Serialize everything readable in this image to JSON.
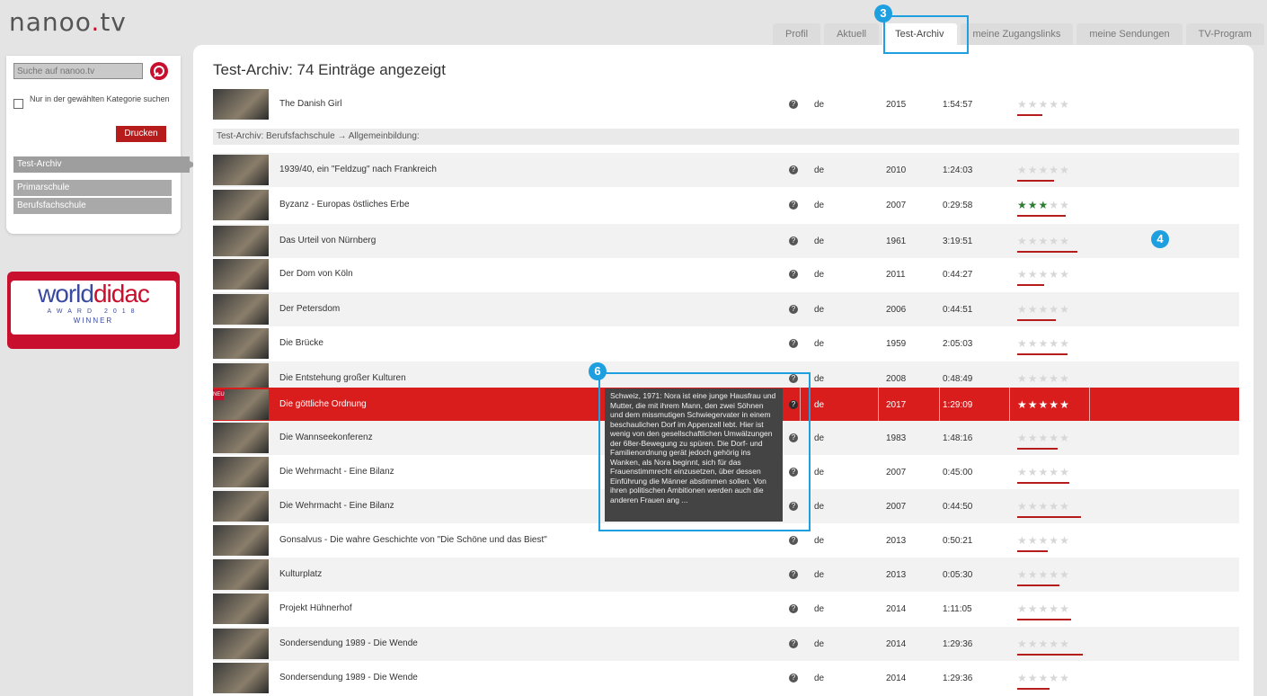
{
  "header": {
    "logo": "nanoo.tv",
    "tabs": [
      "Profil",
      "Aktuell",
      "Test-Archiv",
      "meine Zugangslinks",
      "meine Sendungen",
      "TV-Program"
    ]
  },
  "sidebar": {
    "search_placeholder": "Suche auf nanoo.tv",
    "category_label": "Nur in der gewählten Kategorie suchen",
    "print_label": "Drucken",
    "nav": [
      "Test-Archiv",
      "Primarschule",
      "Berufsfachschule"
    ]
  },
  "award": {
    "word1": "world",
    "word2": "didac",
    "sub": "AWARD 2018",
    "winner": "WINNER"
  },
  "main": {
    "title": "Test-Archiv: 74 Einträge angezeigt",
    "section": "Test-Archiv: Berufsfachschule → Allgemeinbildung:",
    "rows": [
      {
        "title": "The Danish Girl",
        "lang": "de",
        "year": "2015",
        "duration": "1:54:57",
        "rating": 0
      },
      {
        "title": "1939/40, ein \"Feldzug\" nach Frankreich",
        "lang": "de",
        "year": "2010",
        "duration": "1:24:03",
        "rating": 0
      },
      {
        "title": "Byzanz - Europas östliches Erbe",
        "lang": "de",
        "year": "2007",
        "duration": "0:29:58",
        "rating": 3
      },
      {
        "title": "Das Urteil von Nürnberg",
        "lang": "de",
        "year": "1961",
        "duration": "3:19:51",
        "rating": 0
      },
      {
        "title": "Der Dom von Köln",
        "lang": "de",
        "year": "2011",
        "duration": "0:44:27",
        "rating": 0
      },
      {
        "title": "Der Petersdom",
        "lang": "de",
        "year": "2006",
        "duration": "0:44:51",
        "rating": 0
      },
      {
        "title": "Die Brücke",
        "lang": "de",
        "year": "1959",
        "duration": "2:05:03",
        "rating": 0
      },
      {
        "title": "Die Entstehung großer Kulturen",
        "lang": "de",
        "year": "2008",
        "duration": "0:48:49",
        "rating": 0
      },
      {
        "title": "Die göttliche Ordnung",
        "lang": "de",
        "year": "2017",
        "duration": "1:29:09",
        "rating": 5,
        "badge": "NEU"
      },
      {
        "title": "Die Wannseekonferenz",
        "lang": "de",
        "year": "1983",
        "duration": "1:48:16",
        "rating": 0
      },
      {
        "title": "Die Wehrmacht - Eine Bilanz",
        "lang": "de",
        "year": "2007",
        "duration": "0:45:00",
        "rating": 0
      },
      {
        "title": "Die Wehrmacht - Eine Bilanz",
        "lang": "de",
        "year": "2007",
        "duration": "0:44:50",
        "rating": 0
      },
      {
        "title": "Gonsalvus - Die wahre Geschichte von \"Die Schöne und das Biest\"",
        "lang": "de",
        "year": "2013",
        "duration": "0:50:21",
        "rating": 0
      },
      {
        "title": "Kulturplatz",
        "lang": "de",
        "year": "2013",
        "duration": "0:05:30",
        "rating": 0
      },
      {
        "title": "Projekt Hühnerhof",
        "lang": "de",
        "year": "2014",
        "duration": "1:11:05",
        "rating": 0
      },
      {
        "title": "Sondersendung 1989 - Die Wende",
        "lang": "de",
        "year": "2014",
        "duration": "1:29:36",
        "rating": 0
      },
      {
        "title": "Sondersendung 1989 - Die Wende",
        "lang": "de",
        "year": "2014",
        "duration": "1:29:36",
        "rating": 0
      }
    ]
  },
  "tooltip": "Schweiz, 1971: Nora ist eine junge Hausfrau und Mutter, die mit ihrem Mann, den zwei Söhnen und dem missmutigen Schwiegervater in einem beschaulichen Dorf im Appenzell lebt. Hier ist wenig von den gesellschaftlichen Umwälzungen der 68er-Bewegung zu spüren. Die Dorf- und Familienordnung gerät jedoch gehörig ins Wanken, als Nora beginnt, sich für das Frauenstimmrecht einzusetzen, über dessen Einführung die Männer abstimmen sollen. Von ihren politischen Ambitionen werden auch die anderen Frauen ang ...",
  "callouts": [
    "3",
    "4",
    "6"
  ],
  "colors": {
    "accent": "#c8102e",
    "highlight": "#d91d1d",
    "callout": "#1ea0e0"
  }
}
